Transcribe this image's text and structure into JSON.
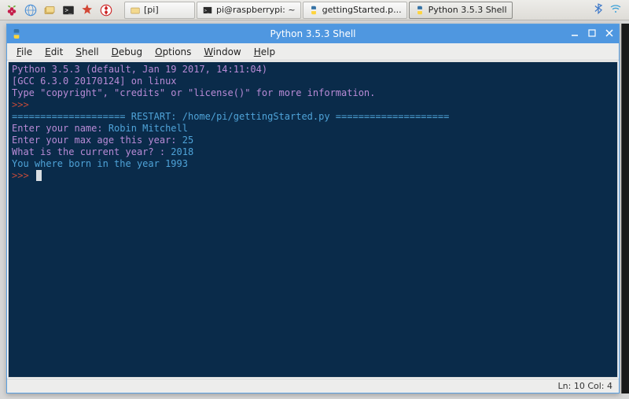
{
  "taskbar": {
    "items": [
      {
        "label": "[pi]"
      },
      {
        "label": "pi@raspberrypi: ~"
      },
      {
        "label": "gettingStarted.p..."
      },
      {
        "label": "Python 3.5.3 Shell"
      }
    ]
  },
  "window": {
    "title": "Python 3.5.3 Shell",
    "menus": [
      "File",
      "Edit",
      "Shell",
      "Debug",
      "Options",
      "Window",
      "Help"
    ]
  },
  "terminal": {
    "line1": "Python 3.5.3 (default, Jan 19 2017, 14:11:04) ",
    "line2": "[GCC 6.3.0 20170124] on linux",
    "line3": "Type \"copyright\", \"credits\" or \"license()\" for more information.",
    "prompt": ">>> ",
    "restart": "==================== RESTART: /home/pi/gettingStarted.py ====================",
    "q1": "Enter your name: ",
    "a1": "Robin Mitchell",
    "q2": "Enter your max age this year: ",
    "a2": "25",
    "q3": "What is the current year? : ",
    "a3": "2018",
    "result": "You where born in the year 1993"
  },
  "status": {
    "pos": "Ln: 10   Col: 4"
  }
}
